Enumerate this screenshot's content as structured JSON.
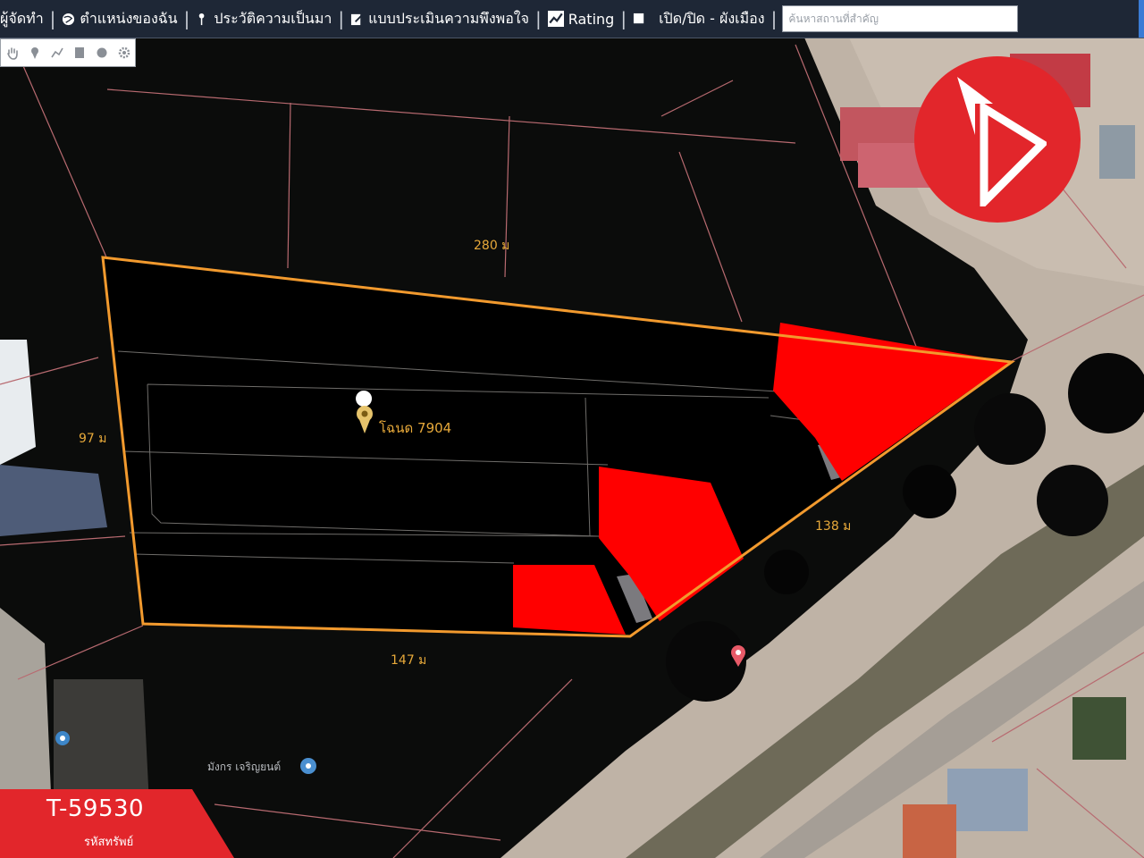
{
  "toolbar": {
    "items": [
      {
        "label": "ผู้จัดทำ",
        "icon": "user-icon"
      },
      {
        "label": "ตำแหน่งของฉัน",
        "icon": "globe-icon"
      },
      {
        "label": "ประวัติความเป็นมา",
        "icon": "pin-icon"
      },
      {
        "label": "แบบประเมินความพึงพอใจ",
        "icon": "edit-icon"
      },
      {
        "label": "Rating",
        "icon": "rating-icon"
      },
      {
        "label": "เปิด/ปิด - ผังเมือง",
        "icon": "checkbox-icon"
      }
    ],
    "search_placeholder": "ค้นหาสถานที่สำคัญ"
  },
  "tool_palette": {
    "tools": [
      "hand-icon",
      "marker-icon",
      "line-icon",
      "polygon-icon",
      "circle-icon",
      "settings-icon"
    ]
  },
  "map": {
    "parcel_label": "โฉนด 7904",
    "dimensions": {
      "top": "280 ม",
      "left": "97 ม",
      "bottom": "147 ม",
      "right": "138 ม"
    },
    "place_labels": [
      "มังกร เจริญยนต์"
    ],
    "colors": {
      "boundary": "#f29a2e",
      "highlight": "#ff0000",
      "parcel_fill": "#000000",
      "label": "#e7a93a"
    }
  },
  "brand": {
    "logo": "brand-logo",
    "color": "#e2262b"
  },
  "property_code": {
    "code": "T-59530",
    "caption": "รหัสทรัพย์"
  }
}
